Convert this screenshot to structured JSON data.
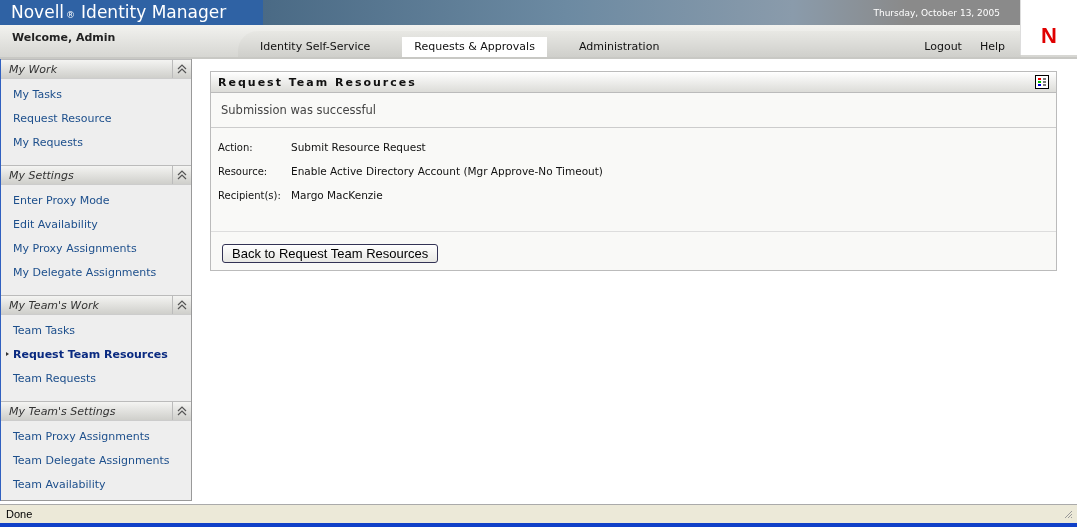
{
  "header": {
    "product": "Novell",
    "trademark": "®",
    "title": "Identity Manager",
    "date": "Thursday, October 13, 2005",
    "logo": "N"
  },
  "welcome": "Welcome, Admin",
  "tabs": [
    {
      "label": "Identity Self-Service",
      "selected": false
    },
    {
      "label": "Requests & Approvals",
      "selected": true
    },
    {
      "label": "Administration",
      "selected": false
    }
  ],
  "links": [
    "Logout",
    "Help"
  ],
  "sidebar": {
    "sections": [
      {
        "title": "My Work",
        "items": [
          {
            "label": "My Tasks",
            "selected": false
          },
          {
            "label": "Request Resource",
            "selected": false
          },
          {
            "label": "My Requests",
            "selected": false
          }
        ]
      },
      {
        "title": "My Settings",
        "items": [
          {
            "label": "Enter Proxy Mode",
            "selected": false
          },
          {
            "label": "Edit Availability",
            "selected": false
          },
          {
            "label": "My Proxy Assignments",
            "selected": false
          },
          {
            "label": "My Delegate Assignments",
            "selected": false
          }
        ]
      },
      {
        "title": "My Team's Work",
        "items": [
          {
            "label": "Team Tasks",
            "selected": false
          },
          {
            "label": "Request Team Resources",
            "selected": true
          },
          {
            "label": "Team Requests",
            "selected": false
          }
        ]
      },
      {
        "title": "My Team's Settings",
        "items": [
          {
            "label": "Team Proxy Assignments",
            "selected": false
          },
          {
            "label": "Team Delegate Assignments",
            "selected": false
          },
          {
            "label": "Team Availability",
            "selected": false
          }
        ]
      }
    ]
  },
  "panel": {
    "title": "Request Team Resources",
    "message": "Submission was successful",
    "fields": [
      {
        "label": "Action:",
        "value": "Submit Resource Request"
      },
      {
        "label": "Resource:",
        "value": "Enable Active Directory Account (Mgr Approve-No Timeout)"
      },
      {
        "label": "Recipient(s):",
        "value": "Margo MacKenzie"
      }
    ],
    "button": "Back to Request Team Resources"
  },
  "status_bar": {
    "text": "Done"
  }
}
